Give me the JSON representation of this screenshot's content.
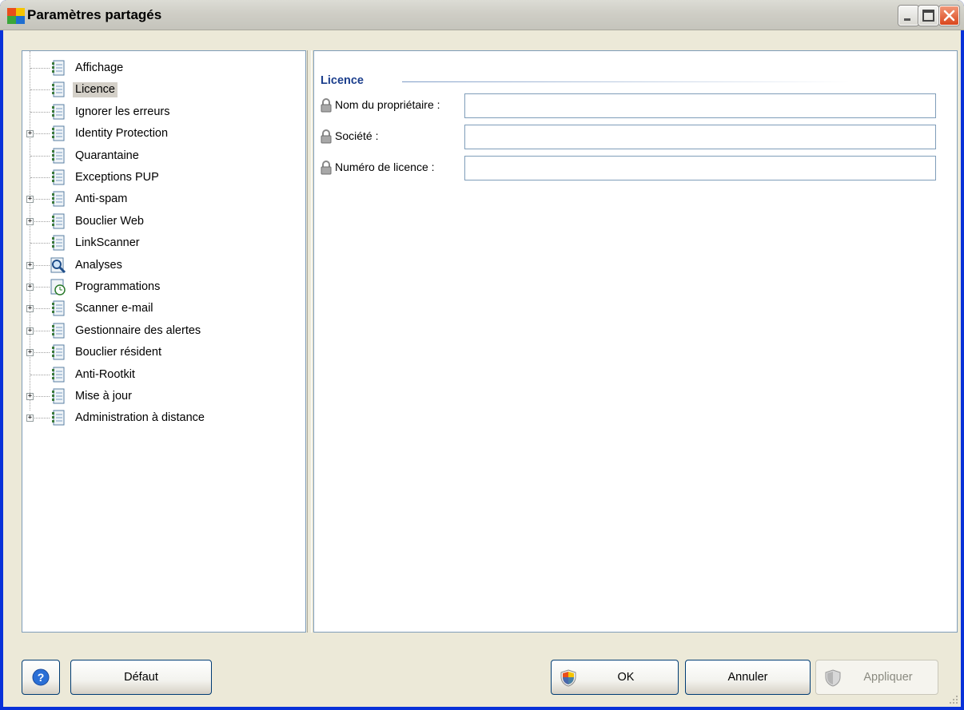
{
  "window": {
    "title": "Paramètres partagés",
    "icon": "avg-logo-icon",
    "controls": [
      "minimize-icon",
      "maximize-icon",
      "close-icon"
    ]
  },
  "tree": {
    "items": [
      {
        "label": "Affichage",
        "expandable": false,
        "selected": false,
        "icon": "settings-page-icon"
      },
      {
        "label": "Licence",
        "expandable": false,
        "selected": true,
        "icon": "settings-page-icon"
      },
      {
        "label": "Ignorer les erreurs",
        "expandable": false,
        "selected": false,
        "icon": "settings-page-icon"
      },
      {
        "label": "Identity Protection",
        "expandable": true,
        "selected": false,
        "icon": "settings-page-icon"
      },
      {
        "label": "Quarantaine",
        "expandable": false,
        "selected": false,
        "icon": "settings-page-icon"
      },
      {
        "label": "Exceptions PUP",
        "expandable": false,
        "selected": false,
        "icon": "settings-page-icon"
      },
      {
        "label": "Anti-spam",
        "expandable": true,
        "selected": false,
        "icon": "settings-page-icon"
      },
      {
        "label": "Bouclier Web",
        "expandable": true,
        "selected": false,
        "icon": "settings-page-icon"
      },
      {
        "label": "LinkScanner",
        "expandable": false,
        "selected": false,
        "icon": "settings-page-icon"
      },
      {
        "label": "Analyses",
        "expandable": true,
        "selected": false,
        "icon": "scan-magnifier-icon"
      },
      {
        "label": "Programmations",
        "expandable": true,
        "selected": false,
        "icon": "schedule-clock-icon"
      },
      {
        "label": "Scanner e-mail",
        "expandable": true,
        "selected": false,
        "icon": "settings-page-icon"
      },
      {
        "label": "Gestionnaire des alertes",
        "expandable": true,
        "selected": false,
        "icon": "settings-page-icon"
      },
      {
        "label": "Bouclier résident",
        "expandable": true,
        "selected": false,
        "icon": "settings-page-icon"
      },
      {
        "label": "Anti-Rootkit",
        "expandable": false,
        "selected": false,
        "icon": "settings-page-icon"
      },
      {
        "label": "Mise à jour",
        "expandable": true,
        "selected": false,
        "icon": "settings-page-icon"
      },
      {
        "label": "Administration à distance",
        "expandable": true,
        "selected": false,
        "icon": "settings-page-icon"
      }
    ],
    "expander_glyph": "+"
  },
  "license": {
    "section_title": "Licence",
    "fields": [
      {
        "label": "Nom du propriétaire :",
        "value": ""
      },
      {
        "label": "Société :",
        "value": ""
      },
      {
        "label": "Numéro de licence :",
        "value": ""
      }
    ]
  },
  "buttons": {
    "help_icon": "help-question-icon",
    "default_label": "Défaut",
    "ok_label": "OK",
    "cancel_label": "Annuler",
    "apply_label": "Appliquer"
  }
}
